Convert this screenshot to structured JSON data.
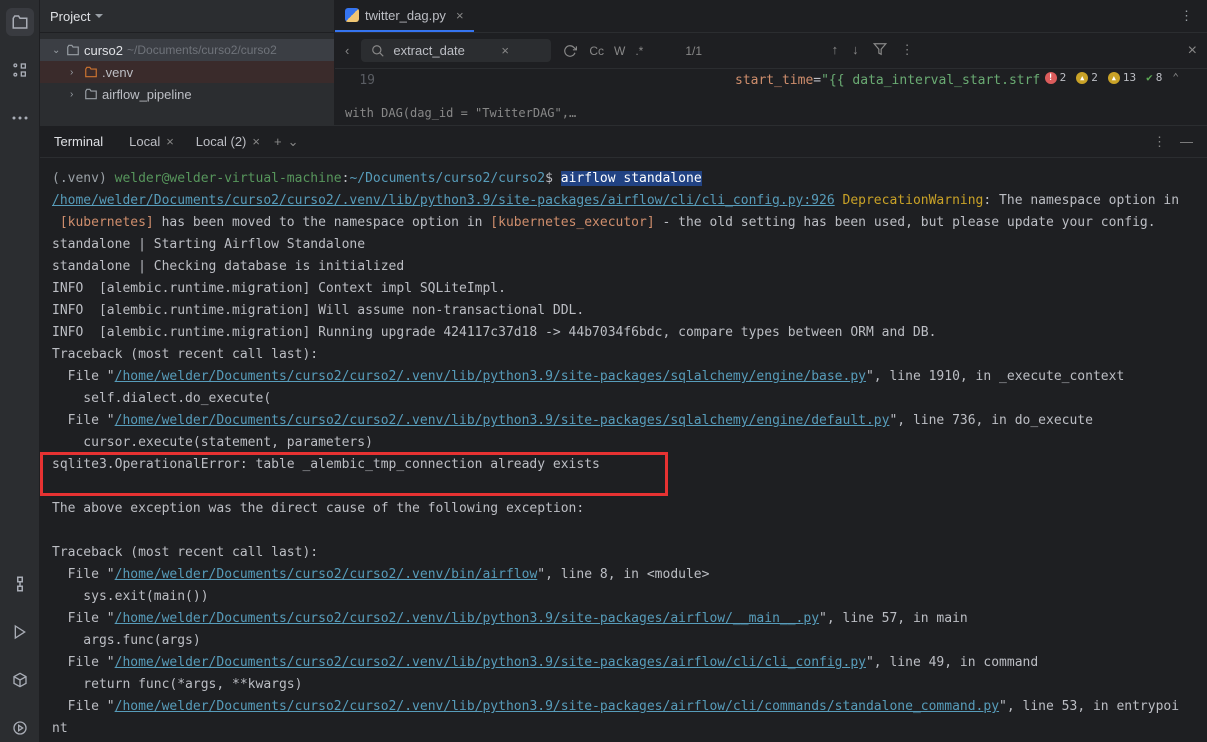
{
  "project": {
    "title": "Project",
    "root": "curso2",
    "root_path": "~/Documents/curso2/curso2",
    "folders": [
      {
        "name": ".venv",
        "orange": true
      },
      {
        "name": "airflow_pipeline",
        "orange": false
      }
    ]
  },
  "editor": {
    "tab_filename": "twitter_dag.py",
    "search_value": "extract_date",
    "search_count": "1/1",
    "search_opts": {
      "cc": "Cc",
      "w": "W",
      "regex": ".*"
    },
    "line_number": "19",
    "code_prefix": "start_time",
    "code_eq": "=",
    "code_str": "\"{{ data_interval_start.strf",
    "crumb": "with DAG(dag_id = \"TwitterDAG\",…",
    "inspections": {
      "errors": "2",
      "warnings": "2",
      "weak": "13",
      "ok": "8"
    }
  },
  "terminal": {
    "title": "Terminal",
    "tabs": [
      {
        "label": "Local"
      },
      {
        "label": "Local (2)"
      }
    ],
    "prompt": {
      "venv": "(.venv)",
      "userhost": "welder@welder-virtual-machine",
      "colon": ":",
      "path": "~/Documents/curso2/curso2",
      "dollar": "$",
      "cmd": "airflow standalone"
    },
    "lines": {
      "l1_link": "/home/welder/Documents/curso2/curso2/.venv/lib/python3.9/site-packages/airflow/cli/cli_config.py:926",
      "l1_warn": "DeprecationWarning",
      "l1_rest": ": The namespace option in ",
      "l2_a": "[kubernetes]",
      "l2_b": " has been moved to the namespace option in ",
      "l2_c": "[kubernetes_executor]",
      "l2_d": " - the old setting has been used, but please update your config.",
      "l3": "standalone | Starting Airflow Standalone",
      "l4": "standalone | Checking database is initialized",
      "l5": "INFO  [alembic.runtime.migration] Context impl SQLiteImpl.",
      "l6": "INFO  [alembic.runtime.migration] Will assume non-transactional DDL.",
      "l7": "INFO  [alembic.runtime.migration] Running upgrade 424117c37d18 -> 44b7034f6bdc, compare types between ORM and DB.",
      "l8": "Traceback (most recent call last):",
      "l9_a": "  File \"",
      "l9_link": "/home/welder/Documents/curso2/curso2/.venv/lib/python3.9/site-packages/sqlalchemy/engine/base.py",
      "l9_b": "\", line 1910, in _execute_context",
      "l10": "    self.dialect.do_execute(",
      "l11_a": "  File \"",
      "l11_link": "/home/welder/Documents/curso2/curso2/.venv/lib/python3.9/site-packages/sqlalchemy/engine/default.py",
      "l11_b": "\", line 736, in do_execute",
      "l12": "    cursor.execute(statement, parameters)",
      "l13": "sqlite3.OperationalError: table _alembic_tmp_connection already exists",
      "l15": "The above exception was the direct cause of the following exception:",
      "l17": "Traceback (most recent call last):",
      "l18_a": "  File \"",
      "l18_link": "/home/welder/Documents/curso2/curso2/.venv/bin/airflow",
      "l18_b": "\", line 8, in <module>",
      "l19": "    sys.exit(main())",
      "l20_a": "  File \"",
      "l20_link": "/home/welder/Documents/curso2/curso2/.venv/lib/python3.9/site-packages/airflow/__main__.py",
      "l20_b": "\", line 57, in main",
      "l21": "    args.func(args)",
      "l22_a": "  File \"",
      "l22_link": "/home/welder/Documents/curso2/curso2/.venv/lib/python3.9/site-packages/airflow/cli/cli_config.py",
      "l22_b": "\", line 49, in command",
      "l23": "    return func(*args, **kwargs)",
      "l24_a": "  File \"",
      "l24_link": "/home/welder/Documents/curso2/curso2/.venv/lib/python3.9/site-packages/airflow/cli/commands/standalone_command.py",
      "l24_b": "\", line 53, in entrypoi",
      "l25": "nt"
    }
  }
}
